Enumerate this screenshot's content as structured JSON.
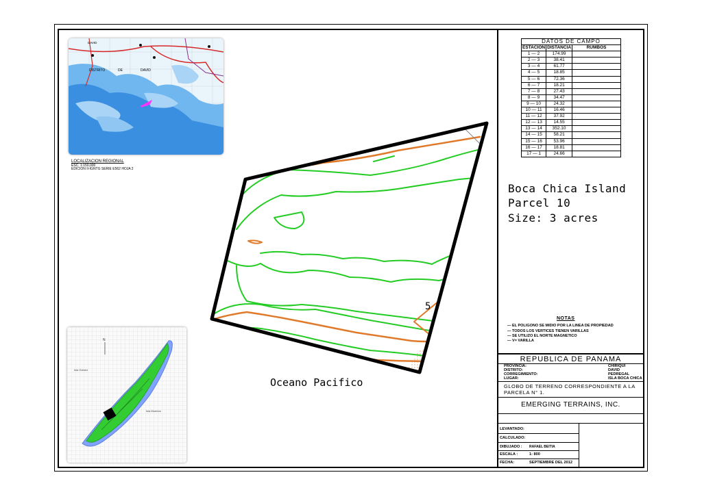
{
  "field_table": {
    "title": "DATOS DE CAMPO",
    "headers": [
      "ESTACION",
      "DISTANCIA",
      "RUMBOS"
    ],
    "rows": [
      {
        "estacion": "1 — 2",
        "distancia": "174.99"
      },
      {
        "estacion": "2 — 3",
        "distancia": "38.41"
      },
      {
        "estacion": "3 — 4",
        "distancia": "61.77"
      },
      {
        "estacion": "4 — 5",
        "distancia": "18.85"
      },
      {
        "estacion": "5 — 6",
        "distancia": "72.36"
      },
      {
        "estacion": "6 — 7",
        "distancia": "18.21"
      },
      {
        "estacion": "7 — 8",
        "distancia": "27.43"
      },
      {
        "estacion": "8 — 9",
        "distancia": "34.47"
      },
      {
        "estacion": "9 — 10",
        "distancia": "24.32"
      },
      {
        "estacion": "10 — 11",
        "distancia": "16.46"
      },
      {
        "estacion": "11 — 12",
        "distancia": "37.92"
      },
      {
        "estacion": "12 — 13",
        "distancia": "14.55"
      },
      {
        "estacion": "13 — 14",
        "distancia": "352.10"
      },
      {
        "estacion": "14 — 15",
        "distancia": "58.21"
      },
      {
        "estacion": "15 — 16",
        "distancia": "53.96"
      },
      {
        "estacion": "16 — 17",
        "distancia": "18.81"
      },
      {
        "estacion": "17 — 1",
        "distancia": "24.66"
      }
    ]
  },
  "parcel": {
    "line1": "Boca Chica Island",
    "line2": "Parcel 10",
    "line3": "Size: 3 acres"
  },
  "map": {
    "ocean_label": "Oceano Pacifico",
    "contour_label": "5",
    "regional_caption_1": "LOCALIZACION REGIONAL",
    "regional_caption_2": "ESC. 1:150,000",
    "regional_caption_3": "EDICION II-IGNTG SERIE E562 HOJA 2",
    "regional_place_1": "DAVID",
    "regional_place_2": "DISTRITO",
    "regional_place_3": "DE",
    "regional_place_4": "DAVID",
    "island_label_1": "Isla Gamez",
    "island_label_2": "Isla Muertos",
    "north_symbol": "N",
    "colors": {
      "parcel_border": "#000000",
      "contour_green": "#22cc22",
      "contour_orange": "#e07a2a",
      "water_blue": "#3a8fe0",
      "island_green": "#33cc33"
    }
  },
  "notes": {
    "title": "NOTAS",
    "items": [
      "—   EL POLIGONO SE MIDIO POR LA LINEA DE PROPIEDAD",
      "—   TODOS LOS VERTICES TIENEN VARILLAS",
      "—   SE UTILIZO EL NORTE MAGNETICO",
      "—   V= VARILLA"
    ]
  },
  "title_block": {
    "republic": "REPUBLICA DE PANAMA",
    "provincia_label": "PROVINCIA:",
    "provincia_value": "CHIRIQUI",
    "distrito_label": "DISTRITO:",
    "distrito_value": "DAVID",
    "corregimiento_label": "CORREGIMIENTO:",
    "corregimiento_value": "PEDREGAL",
    "lugar_label": "LUGAR:",
    "lugar_value": "ISLA BOCA CHICA",
    "globo_text": "GLOBO DE TERRENO CORRESPONDIENTE A LA PARCELA N° 1.",
    "company": "EMERGING TERRAINS, INC.",
    "levantado_label": "LEVANTADO:",
    "calculado_label": "CALCULADO:",
    "dibujado_label": "DIBUJADO :",
    "dibujado_value": "RAFAEL BEITIA",
    "escala_label": "ESCALA :",
    "escala_value": "1: 800",
    "fecha_label": "FECHA:",
    "fecha_value": "SEPTIEMBRE DEL 2012"
  }
}
